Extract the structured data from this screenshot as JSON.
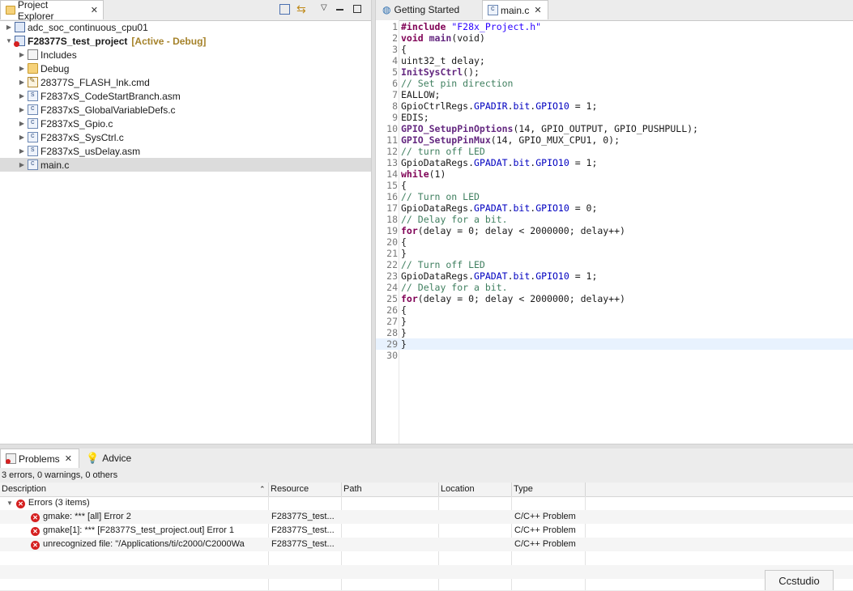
{
  "project_explorer": {
    "tab_label": "Project Explorer",
    "items": [
      {
        "label": "adc_soc_continuous_cpu01",
        "indent": 0,
        "icon": "project-icon",
        "expanded": false
      },
      {
        "label": "F28377S_test_project",
        "tag": "[Active - Debug]",
        "indent": 0,
        "icon": "project-error-icon",
        "expanded": true
      },
      {
        "label": "Includes",
        "indent": 1,
        "icon": "includes-icon"
      },
      {
        "label": "Debug",
        "indent": 1,
        "icon": "folder-icon"
      },
      {
        "label": "28377S_FLASH_lnk.cmd",
        "indent": 1,
        "icon": "cmd-file-icon"
      },
      {
        "label": "F2837xS_CodeStartBranch.asm",
        "indent": 1,
        "icon": "asm-file-icon"
      },
      {
        "label": "F2837xS_GlobalVariableDefs.c",
        "indent": 1,
        "icon": "c-file-icon"
      },
      {
        "label": "F2837xS_Gpio.c",
        "indent": 1,
        "icon": "c-file-icon"
      },
      {
        "label": "F2837xS_SysCtrl.c",
        "indent": 1,
        "icon": "c-file-icon"
      },
      {
        "label": "F2837xS_usDelay.asm",
        "indent": 1,
        "icon": "asm-file-icon"
      },
      {
        "label": "main.c",
        "indent": 1,
        "icon": "c-file-icon",
        "selected": true
      }
    ]
  },
  "editor": {
    "tabs": [
      {
        "label": "Getting Started",
        "icon": "globe-icon",
        "active": false
      },
      {
        "label": "main.c",
        "icon": "c-file-icon",
        "active": true
      }
    ],
    "lines": [
      [
        [
          "kw",
          "#include "
        ],
        [
          "str",
          "\"F28x_Project.h\""
        ]
      ],
      [
        [
          "kw",
          "void "
        ],
        [
          "fn",
          "main"
        ],
        [
          "",
          "(void)"
        ]
      ],
      [
        [
          "",
          "{"
        ]
      ],
      [
        [
          "",
          "uint32_t delay;"
        ]
      ],
      [
        [
          "fn",
          "InitSysCtrl"
        ],
        [
          "",
          "();"
        ]
      ],
      [
        [
          "cm",
          "// Set pin direction"
        ]
      ],
      [
        [
          "",
          "EALLOW;"
        ]
      ],
      [
        [
          "",
          "GpioCtrlRegs."
        ],
        [
          "fld",
          "GPADIR"
        ],
        [
          "",
          "."
        ],
        [
          "fld",
          "bit"
        ],
        [
          "",
          "."
        ],
        [
          "fld",
          "GPIO10"
        ],
        [
          "",
          " = 1;"
        ]
      ],
      [
        [
          "",
          "EDIS;"
        ]
      ],
      [
        [
          "fn",
          "GPIO_SetupPinOptions"
        ],
        [
          "",
          "(14, GPIO_OUTPUT, GPIO_PUSHPULL);"
        ]
      ],
      [
        [
          "fn",
          "GPIO_SetupPinMux"
        ],
        [
          "",
          "(14, GPIO_MUX_CPU1, 0);"
        ]
      ],
      [
        [
          "cm",
          "// turn off LED"
        ]
      ],
      [
        [
          "",
          "GpioDataRegs."
        ],
        [
          "fld",
          "GPADAT"
        ],
        [
          "",
          "."
        ],
        [
          "fld",
          "bit"
        ],
        [
          "",
          "."
        ],
        [
          "fld",
          "GPIO10"
        ],
        [
          "",
          " = 1;"
        ]
      ],
      [
        [
          "kw",
          "while"
        ],
        [
          "",
          "(1)"
        ]
      ],
      [
        [
          "",
          "{"
        ]
      ],
      [
        [
          "cm",
          "// Turn on LED"
        ]
      ],
      [
        [
          "",
          "GpioDataRegs."
        ],
        [
          "fld",
          "GPADAT"
        ],
        [
          "",
          "."
        ],
        [
          "fld",
          "bit"
        ],
        [
          "",
          "."
        ],
        [
          "fld",
          "GPIO10"
        ],
        [
          "",
          " = 0;"
        ]
      ],
      [
        [
          "cm",
          "// Delay for a bit."
        ]
      ],
      [
        [
          "kw",
          "for"
        ],
        [
          "",
          "(delay = 0; delay < 2000000; delay++)"
        ]
      ],
      [
        [
          "",
          "{"
        ]
      ],
      [
        [
          "",
          "}"
        ]
      ],
      [
        [
          "cm",
          "// Turn off LED"
        ]
      ],
      [
        [
          "",
          "GpioDataRegs."
        ],
        [
          "fld",
          "GPADAT"
        ],
        [
          "",
          "."
        ],
        [
          "fld",
          "bit"
        ],
        [
          "",
          "."
        ],
        [
          "fld",
          "GPIO10"
        ],
        [
          "",
          " = 1;"
        ]
      ],
      [
        [
          "cm",
          "// Delay for a bit."
        ]
      ],
      [
        [
          "kw",
          "for"
        ],
        [
          "",
          "(delay = 0; delay < 2000000; delay++)"
        ]
      ],
      [
        [
          "",
          "{"
        ]
      ],
      [
        [
          "",
          "}"
        ]
      ],
      [
        [
          "",
          "}"
        ]
      ],
      [
        [
          "",
          "}"
        ]
      ],
      []
    ],
    "current_line": 29
  },
  "problems": {
    "tabs": [
      {
        "label": "Problems",
        "icon": "problems-icon",
        "active": true
      },
      {
        "label": "Advice",
        "icon": "lightbulb-icon",
        "active": false
      }
    ],
    "summary": "3 errors, 0 warnings, 0 others",
    "columns": [
      "Description",
      "Resource",
      "Path",
      "Location",
      "Type"
    ],
    "group_label": "Errors (3 items)",
    "rows": [
      {
        "description": "gmake: *** [all] Error 2",
        "resource": "F28377S_test...",
        "path": "",
        "location": "",
        "type": "C/C++ Problem"
      },
      {
        "description": "gmake[1]: *** [F28377S_test_project.out] Error 1",
        "resource": "F28377S_test...",
        "path": "",
        "location": "",
        "type": "C/C++ Problem"
      },
      {
        "description": "unrecognized file:  \"/Applications/ti/c2000/C2000Wa",
        "resource": "F28377S_test...",
        "path": "",
        "location": "",
        "type": "C/C++ Problem"
      }
    ]
  },
  "status": {
    "app_label": "Ccstudio"
  }
}
